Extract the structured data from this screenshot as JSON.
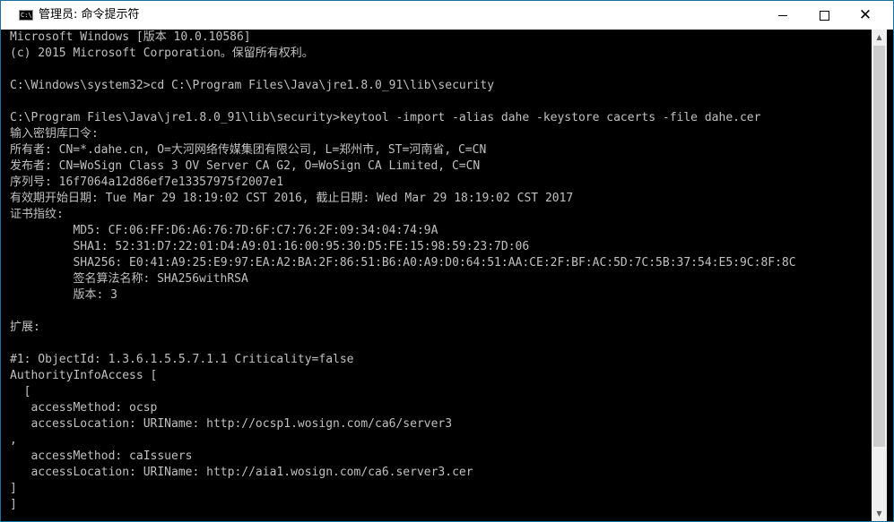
{
  "window": {
    "title": "管理员: 命令提示符",
    "icon_text": "C:\\"
  },
  "controls": {
    "minimize_icon": "minimize-icon",
    "maximize_icon": "maximize-icon",
    "close_icon": "close-icon",
    "close_glyph": "✕"
  },
  "scrollbar": {
    "up_glyph": "▲",
    "down_glyph": "▼"
  },
  "console": {
    "lines": [
      "Microsoft Windows [版本 10.0.10586]",
      "(c) 2015 Microsoft Corporation。保留所有权利。",
      "",
      "C:\\Windows\\system32>cd C:\\Program Files\\Java\\jre1.8.0_91\\lib\\security",
      "",
      "C:\\Program Files\\Java\\jre1.8.0_91\\lib\\security>keytool -import -alias dahe -keystore cacerts -file dahe.cer",
      "输入密钥库口令:",
      "所有者: CN=*.dahe.cn, O=大河网络传媒集团有限公司, L=郑州市, ST=河南省, C=CN",
      "发布者: CN=WoSign Class 3 OV Server CA G2, O=WoSign CA Limited, C=CN",
      "序列号: 16f7064a12d86ef7e13357975f2007e1",
      "有效期开始日期: Tue Mar 29 18:19:02 CST 2016, 截止日期: Wed Mar 29 18:19:02 CST 2017",
      "证书指纹:",
      "         MD5: CF:06:FF:D6:A6:76:7D:6F:C7:76:2F:09:34:04:74:9A",
      "         SHA1: 52:31:D7:22:01:D4:A9:01:16:00:95:30:D5:FE:15:98:59:23:7D:06",
      "         SHA256: E0:41:A9:25:E9:97:EA:A2:BA:2F:86:51:B6:A0:A9:D0:64:51:AA:CE:2F:BF:AC:5D:7C:5B:37:54:E5:9C:8F:8C",
      "         签名算法名称: SHA256withRSA",
      "         版本: 3",
      "",
      "扩展:",
      "",
      "#1: ObjectId: 1.3.6.1.5.5.7.1.1 Criticality=false",
      "AuthorityInfoAccess [",
      "  [",
      "   accessMethod: ocsp",
      "   accessLocation: URIName: http://ocsp1.wosign.com/ca6/server3",
      ",",
      "   accessMethod: caIssuers",
      "   accessLocation: URIName: http://aia1.wosign.com/ca6.server3.cer",
      "]",
      "]"
    ]
  }
}
